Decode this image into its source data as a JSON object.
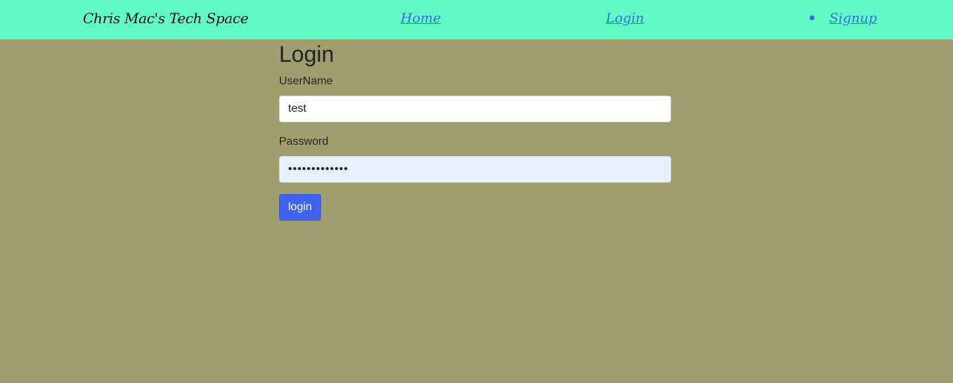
{
  "navbar": {
    "brand": "Chris Mac's Tech Space",
    "links": [
      {
        "label": "Home"
      },
      {
        "label": "Login"
      },
      {
        "label": "Signup"
      }
    ]
  },
  "form": {
    "title": "Login",
    "username": {
      "label": "UserName",
      "value": "test"
    },
    "password": {
      "label": "Password",
      "value": "•••••••••••••"
    },
    "submit_label": "login"
  },
  "colors": {
    "navbar_bg": "#61fac6",
    "page_bg": "#9f9e6c",
    "link": "#3c6ae8",
    "button": "#3f61f0",
    "autofill_bg": "#e8f0fe"
  }
}
